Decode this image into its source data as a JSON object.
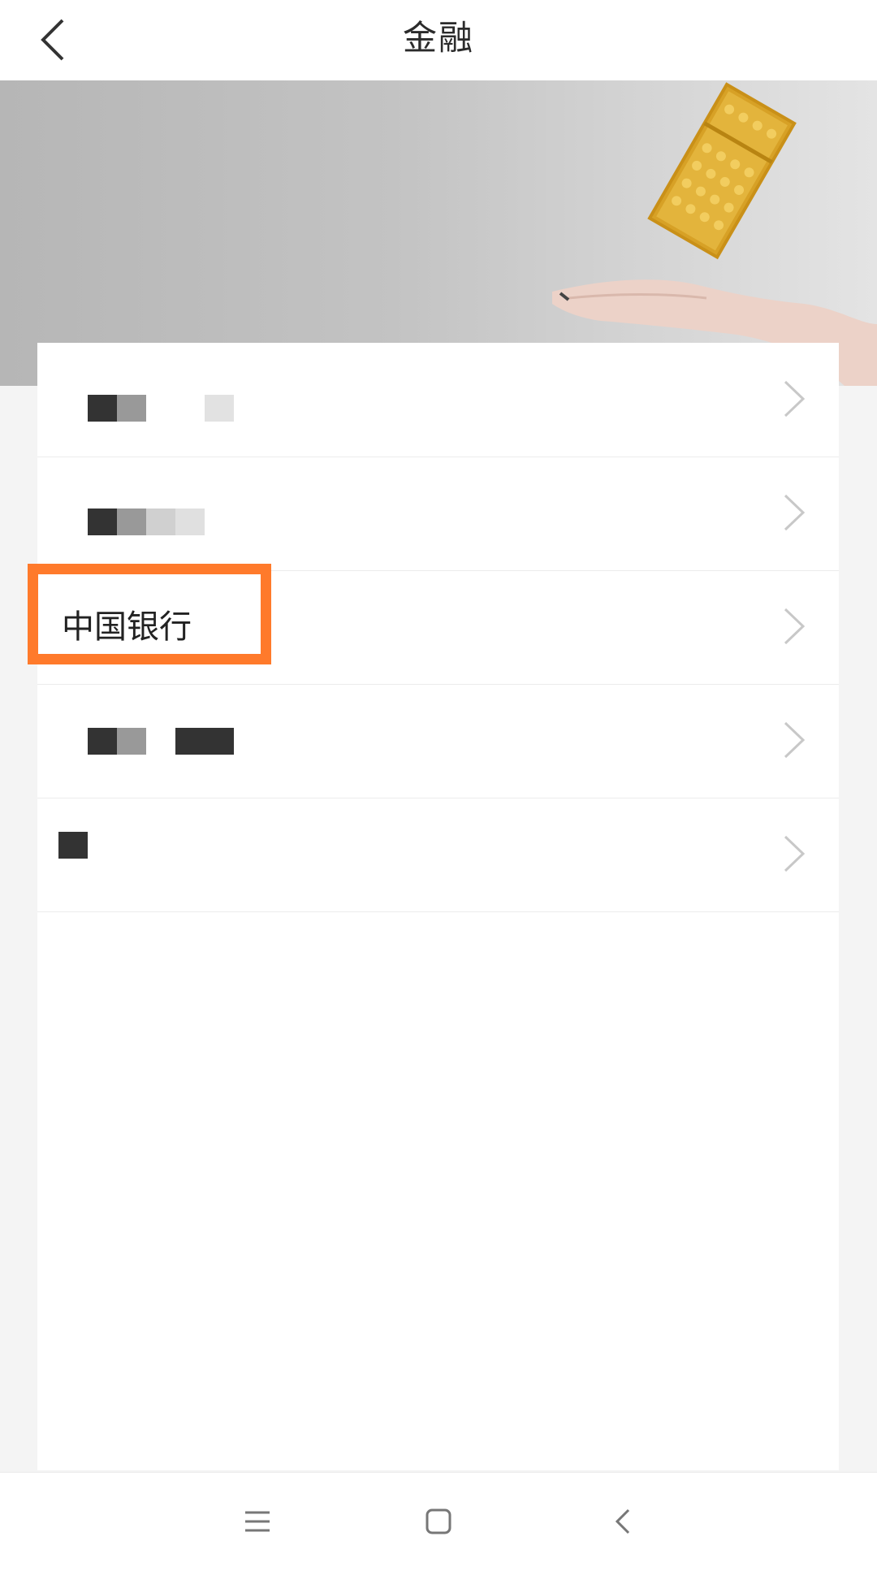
{
  "header": {
    "title": "金融"
  },
  "list": {
    "items": [
      {
        "label": "",
        "masked": true
      },
      {
        "label": "",
        "masked": true
      },
      {
        "label": "中国银行",
        "masked": false,
        "highlighted": true
      },
      {
        "label": "",
        "masked": true
      },
      {
        "label": "",
        "masked": true
      }
    ]
  },
  "colors": {
    "highlight": "#ff7a2b",
    "background": "#f4f4f4"
  },
  "icons": {
    "back": "chevron-left-icon",
    "row_chevron": "chevron-right-icon",
    "nav_menu": "menu-icon",
    "nav_home": "home-square-icon",
    "nav_back": "back-triangle-icon"
  }
}
